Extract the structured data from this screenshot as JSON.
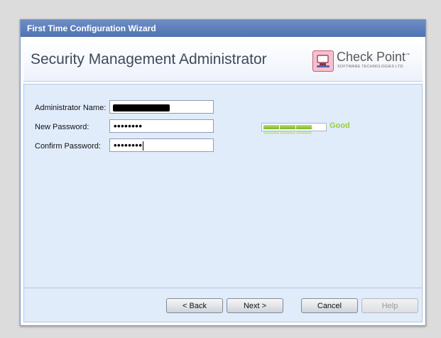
{
  "window": {
    "title": "First Time Configuration Wizard"
  },
  "header": {
    "page_title": "Security Management Administrator",
    "logo": {
      "name": "Check Point",
      "trademark": "™",
      "subtitle": "SOFTWARE TECHNOLOGIES LTD."
    }
  },
  "form": {
    "admin_name": {
      "label": "Administrator Name:",
      "value": ""
    },
    "new_password": {
      "label": "New Password:",
      "value": "••••••••"
    },
    "confirm_password": {
      "label": "Confirm Password:",
      "value": "••••••••"
    },
    "strength": {
      "label": "Good",
      "level_segments": 3,
      "total_segments": 4,
      "color": "#9ccc38"
    }
  },
  "buttons": {
    "back": "< Back",
    "next": "Next >",
    "cancel": "Cancel",
    "help": "Help"
  },
  "colors": {
    "title_bar": "#5b7fbc",
    "panel": "#e1ecfb"
  }
}
